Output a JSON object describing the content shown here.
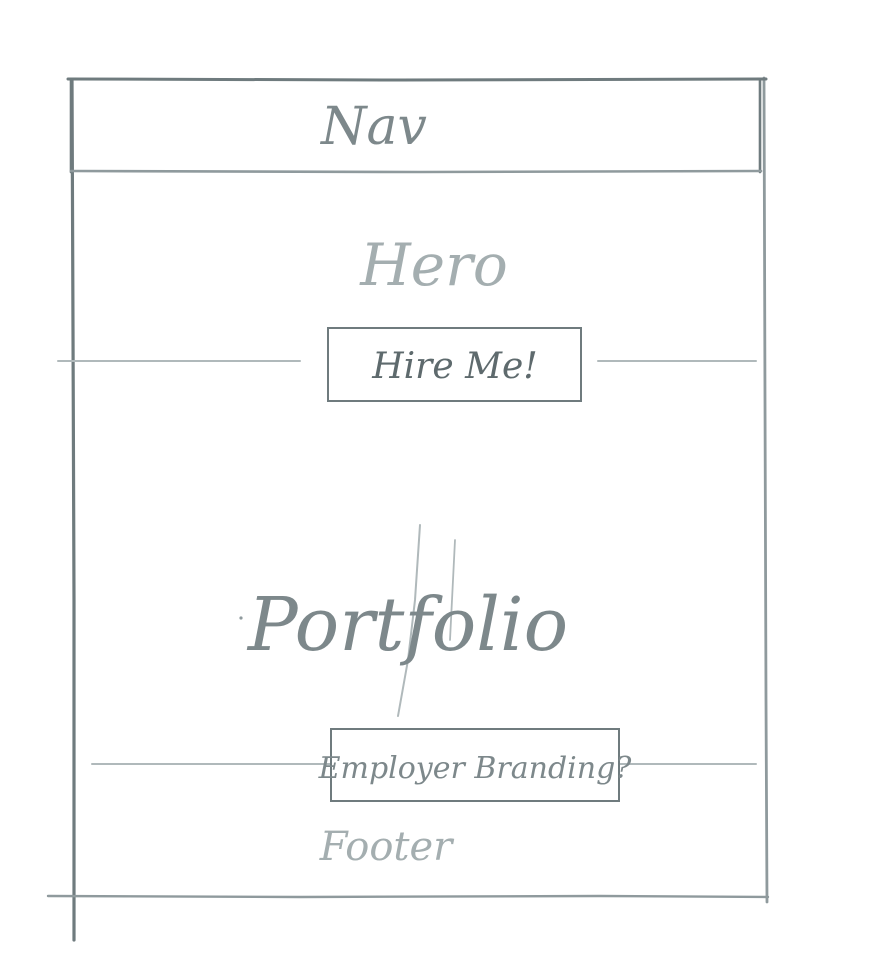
{
  "wireframe": {
    "nav_label": "Nav",
    "hero_label": "Hero",
    "hire_button_label": "Hire Me!",
    "portfolio_label": "Portfolio",
    "branding_button_label": "Employer Branding?",
    "footer_label": "Footer"
  },
  "ink_color": "#7d888b"
}
